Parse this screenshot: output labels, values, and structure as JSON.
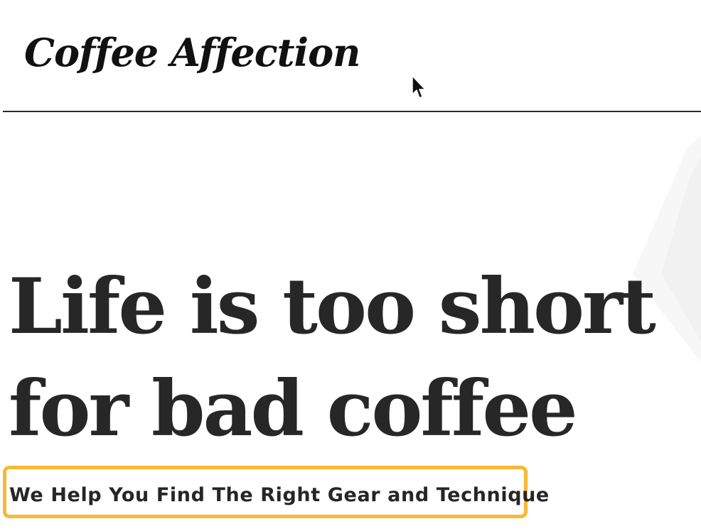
{
  "header": {
    "logo_text": "Coffee Affection"
  },
  "hero": {
    "headline_line1": "Life is too short",
    "headline_line2": "for bad coffee",
    "tagline": "We Help You Find The Right Gear and Technique"
  },
  "colors": {
    "highlight_border": "#fbb735",
    "text": "#272727",
    "background": "#ffffff"
  },
  "icons": {
    "logo_mark": "coffee-cup-icon",
    "pointer": "mouse-cursor-icon"
  }
}
